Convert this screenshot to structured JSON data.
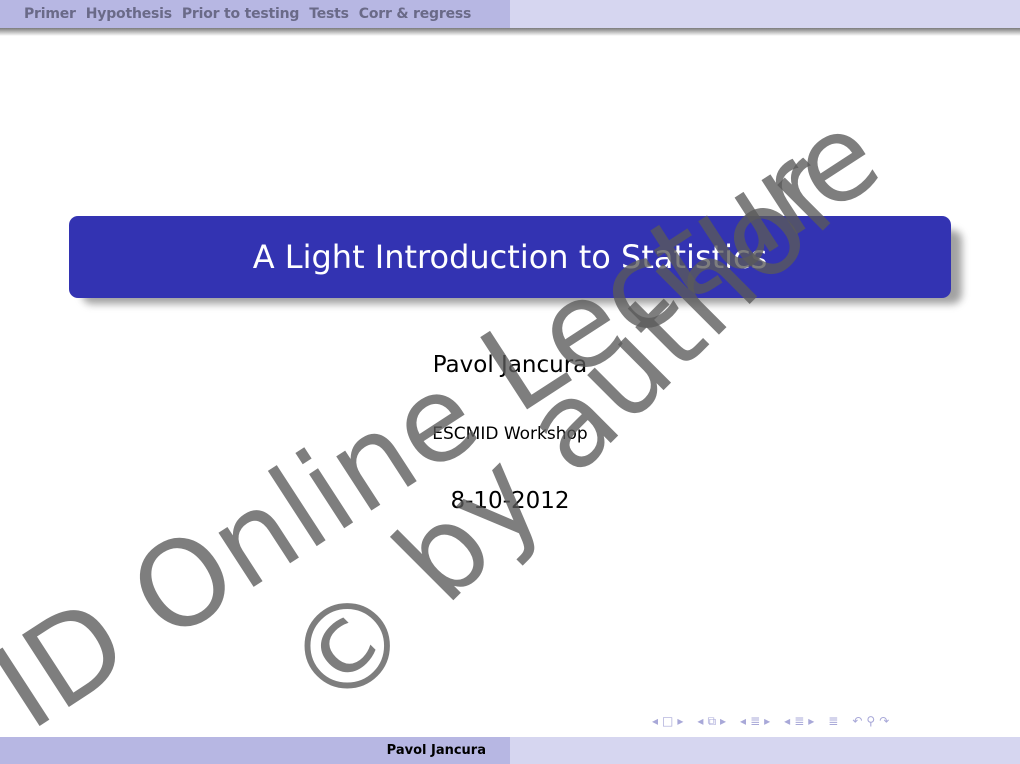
{
  "headline": {
    "nav": [
      "Primer",
      "Hypothesis",
      "Prior to testing",
      "Tests",
      "Corr & regress"
    ]
  },
  "title_slide": {
    "title": "A Light Introduction to Statistics",
    "author": "Pavol Jancura",
    "institute": "ESCMID Workshop",
    "date": "8-10-2012"
  },
  "watermark": {
    "line1": "ID Online Lecture",
    "line2": "© by author"
  },
  "navigation_symbols": {
    "frame_prev": "◂",
    "frame_icon": "□",
    "frame_next": "▸",
    "subsection_prev": "◂",
    "subsection_icon": "⧉",
    "subsection_next": "▸",
    "section_prev": "◂",
    "section_icon": "≣",
    "section_next": "▸",
    "doc_prev": "◂",
    "doc_icon": "≣",
    "doc_next": "▸",
    "toc_icon": "≣",
    "back_icon": "↶",
    "search_icon": "⚲",
    "forward_icon": "↷"
  },
  "footer": {
    "author": "Pavol Jancura"
  },
  "colors": {
    "title_bg": "#3333b2",
    "nav_bg": "#b7b7e3",
    "nav_bg_light": "#d6d6f0"
  }
}
